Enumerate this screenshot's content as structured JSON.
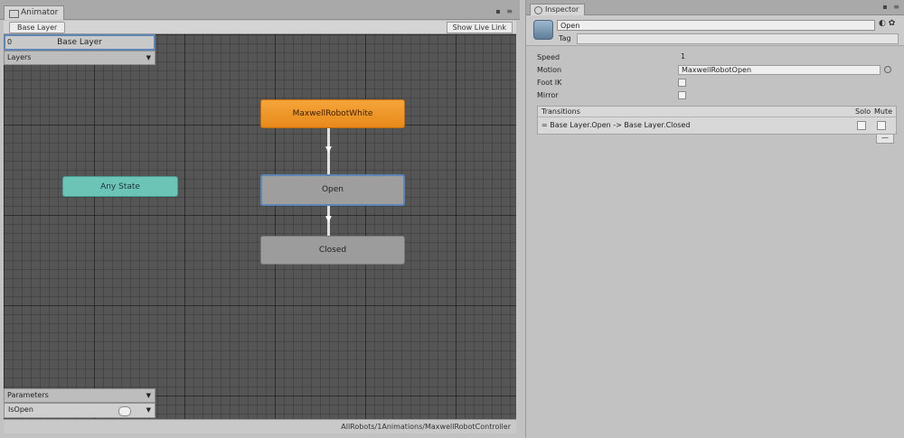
{
  "animator": {
    "tab_label": "Animator",
    "window_buttons": "▪ ≡",
    "breadcrumb": "Base Layer",
    "show_link": "Show Live Link",
    "layers": {
      "index": "0",
      "selected_layer": "Base Layer",
      "header": "Layers"
    },
    "states": {
      "any_state": "Any State",
      "default_state": "MaxwellRobotWhite",
      "open": "Open",
      "closed": "Closed"
    },
    "parameters": {
      "header": "Parameters",
      "param_name": "IsOpen"
    },
    "status_path": "AllRobots/1Animations/MaxwellRobotController"
  },
  "inspector": {
    "tab_label": "Inspector",
    "window_buttons": "▪ ≡",
    "object_name": "Open",
    "tag_label": "Tag",
    "header_icons": "◐ ✿",
    "properties": {
      "speed_label": "Speed",
      "speed_value": "1",
      "motion_label": "Motion",
      "motion_value": "MaxwellRobotOpen",
      "footik_label": "Foot IK",
      "mirror_label": "Mirror"
    },
    "transitions": {
      "header": "Transitions",
      "solo_label": "Solo",
      "mute_label": "Mute",
      "row_label": "=  Base Layer.Open -> Base Layer.Closed",
      "minus": "—"
    }
  }
}
